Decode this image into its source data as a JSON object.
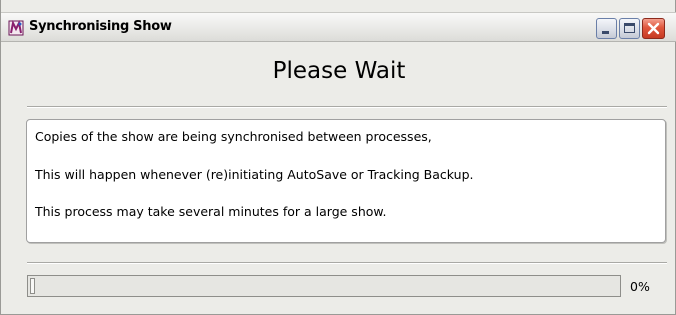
{
  "window": {
    "title": "Synchronising Show",
    "icon": "show-app-icon",
    "controls": {
      "minimize_icon": "minimize-icon",
      "maximize_icon": "maximize-icon",
      "close_icon": "close-icon"
    }
  },
  "dialog": {
    "heading": "Please Wait",
    "messages": [
      "Copies of the show are being synchronised between processes,",
      "This will happen whenever (re)initiating AutoSave or Tracking Backup.",
      "This process may take several minutes for a large show."
    ]
  },
  "progress": {
    "value": 0,
    "label": "0%"
  },
  "colors": {
    "close_button": "#d9482e",
    "icon_magenta": "#8a1f6e"
  }
}
